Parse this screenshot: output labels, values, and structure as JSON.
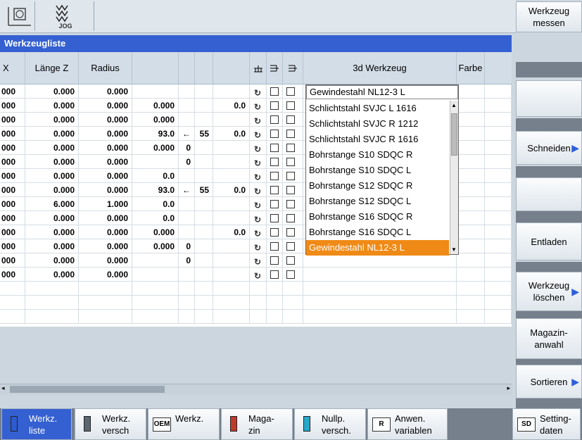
{
  "title": "Werkzeugliste",
  "topbar": {
    "mode_label": "JOG"
  },
  "columns": [
    "X",
    "Länge Z",
    "Radius",
    "",
    "",
    "",
    "",
    "",
    "",
    "",
    "3d Werkzeug",
    "Farbe"
  ],
  "rows": [
    {
      "x": "000",
      "lz": "0.000",
      "rad": "0.000",
      "c4": "",
      "c5": "",
      "c6": "",
      "c7": "",
      "tool": "Gewindestahl NL12-3 L"
    },
    {
      "x": "000",
      "lz": "0.000",
      "rad": "0.000",
      "c4": "0.000",
      "c5": "",
      "c6": "",
      "c7": "0.0",
      "tool": ""
    },
    {
      "x": "000",
      "lz": "0.000",
      "rad": "0.000",
      "c4": "0.000",
      "c5": "",
      "c6": "",
      "c7": "",
      "tool": ""
    },
    {
      "x": "000",
      "lz": "0.000",
      "rad": "0.000",
      "c4": "93.0",
      "c5": "←",
      "c6": "55",
      "c7": "0.0",
      "tool": ""
    },
    {
      "x": "000",
      "lz": "0.000",
      "rad": "0.000",
      "c4": "0.000",
      "c5": "0",
      "c6": "",
      "c7": "",
      "tool": ""
    },
    {
      "x": "000",
      "lz": "0.000",
      "rad": "0.000",
      "c4": "",
      "c5": "0",
      "c6": "",
      "c7": "",
      "tool": ""
    },
    {
      "x": "000",
      "lz": "0.000",
      "rad": "0.000",
      "c4": "0.0",
      "c5": "",
      "c6": "",
      "c7": "",
      "tool": ""
    },
    {
      "x": "000",
      "lz": "0.000",
      "rad": "0.000",
      "c4": "93.0",
      "c5": "←",
      "c6": "55",
      "c7": "0.0",
      "tool": ""
    },
    {
      "x": "000",
      "lz": "6.000",
      "rad": "1.000",
      "c4": "0.0",
      "c5": "",
      "c6": "",
      "c7": "",
      "tool": ""
    },
    {
      "x": "000",
      "lz": "0.000",
      "rad": "0.000",
      "c4": "0.0",
      "c5": "",
      "c6": "",
      "c7": "",
      "tool": ""
    },
    {
      "x": "000",
      "lz": "0.000",
      "rad": "0.000",
      "c4": "0.000",
      "c5": "",
      "c6": "",
      "c7": "0.0",
      "tool": ""
    },
    {
      "x": "000",
      "lz": "0.000",
      "rad": "0.000",
      "c4": "0.000",
      "c5": "0",
      "c6": "",
      "c7": "",
      "tool": ""
    },
    {
      "x": "000",
      "lz": "0.000",
      "rad": "0.000",
      "c4": "",
      "c5": "0",
      "c6": "",
      "c7": "",
      "tool": ""
    },
    {
      "x": "000",
      "lz": "0.000",
      "rad": "0.000",
      "c4": "",
      "c5": "",
      "c6": "",
      "c7": "",
      "tool": ""
    }
  ],
  "dropdown": {
    "selected": "Gewindestahl NL12-3 L",
    "items": [
      "Schlichtstahl SVJC L 1616",
      "Schlichtstahl SVJC R 1212",
      "Schlichtstahl SVJC R 1616",
      "Bohrstange S10 SDQC R",
      "Bohrstange S10 SDQC L",
      "Bohrstange S12 SDQC R",
      "Bohrstange S12 SDQC L",
      "Bohrstange S16 SDQC R",
      "Bohrstange S16 SDQC L",
      "Gewindestahl NL12-3 L"
    ],
    "highlighted_index": 9
  },
  "softkeys_right": [
    {
      "l1": "Werkzeug",
      "l2": "messen"
    },
    {
      "l1": "",
      "l2": ""
    },
    {
      "l1": "Schneiden",
      "l2": ""
    },
    {
      "l1": "",
      "l2": ""
    },
    {
      "l1": "Entladen",
      "l2": ""
    },
    {
      "l1": "Werkzeug",
      "l2": "löschen"
    },
    {
      "l1": "Magazin-",
      "l2": "anwahl"
    },
    {
      "l1": "Sortieren",
      "l2": ""
    }
  ],
  "softkeys_bottom": [
    {
      "l1": "Werkz.",
      "l2": "liste"
    },
    {
      "l1": "Werkz.",
      "l2": "versch"
    },
    {
      "l1": "Werkz.",
      "l2": "",
      "badge": "OEM"
    },
    {
      "l1": "Maga-",
      "l2": "zin"
    },
    {
      "l1": "Nullp.",
      "l2": "versch."
    },
    {
      "l1": "Anwen.",
      "l2": "variablen",
      "badge": "R"
    },
    {
      "l1": "Setting-",
      "l2": "daten",
      "badge": "SD"
    }
  ],
  "colors": {
    "title_bar": "#3460d1",
    "highlight": "#f08a16",
    "softkey_active": "#3460d1"
  }
}
